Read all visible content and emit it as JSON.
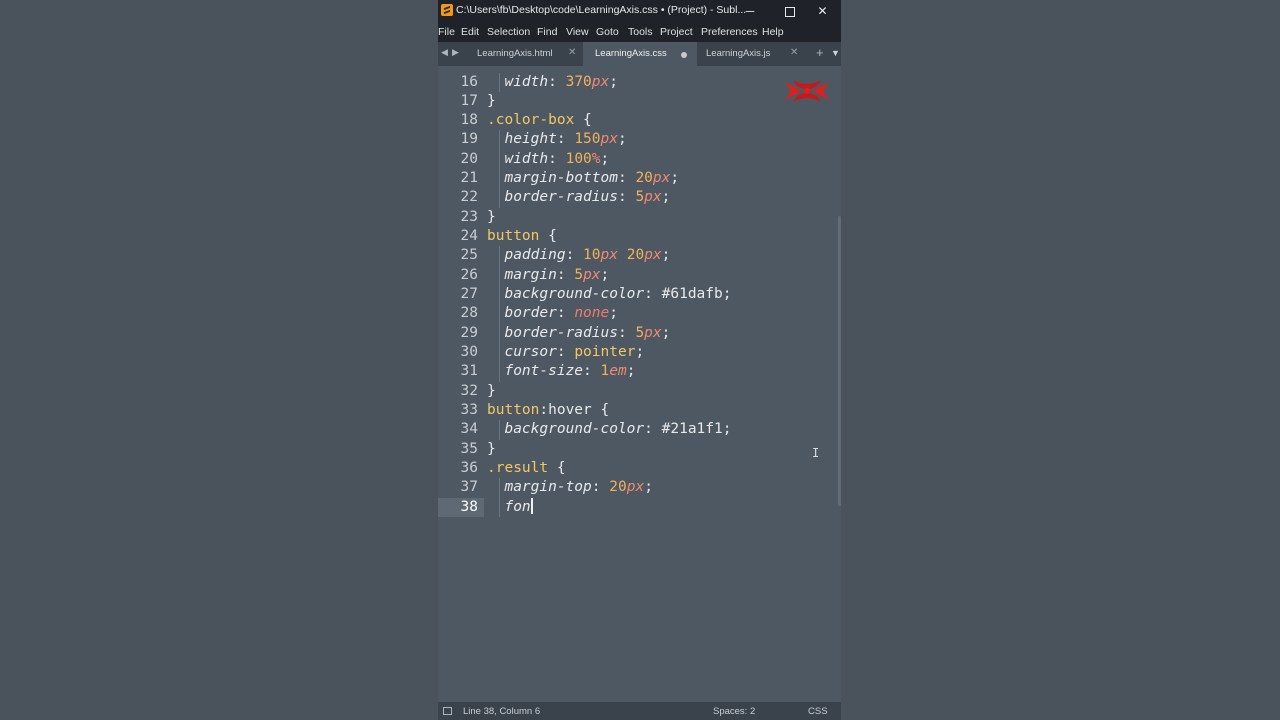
{
  "window": {
    "title": "C:\\Users\\fb\\Desktop\\code\\LearningAxis.css • (Project) - Subl...",
    "controls": {
      "minimize": "─",
      "maximize": "",
      "close": "✕"
    }
  },
  "menu": [
    "File",
    "Edit",
    "Selection",
    "Find",
    "View",
    "Goto",
    "Tools",
    "Project",
    "Preferences",
    "Help"
  ],
  "tabs": [
    {
      "label": "LearningAxis.html",
      "state": "close"
    },
    {
      "label": "LearningAxis.css",
      "state": "modified"
    },
    {
      "label": "LearningAxis.js",
      "state": "close"
    }
  ],
  "tab_controls": {
    "prev": "◀",
    "next": "▶",
    "add": "+",
    "dropdown": "▼",
    "close_glyph": "✕"
  },
  "editor": {
    "current_line": 38,
    "lines": [
      {
        "n": "16",
        "tokens": [
          [
            "i",
            "  "
          ],
          [
            "prop",
            "width"
          ],
          [
            "pc",
            ": "
          ],
          [
            "num",
            "370"
          ],
          [
            "unit",
            "px"
          ],
          [
            "pc",
            ";"
          ]
        ]
      },
      {
        "n": "17",
        "tokens": [
          [
            "pc",
            "}"
          ]
        ]
      },
      {
        "n": "18",
        "tokens": [
          [
            "sel",
            ".color-box"
          ],
          [
            "pc",
            " {"
          ]
        ]
      },
      {
        "n": "19",
        "tokens": [
          [
            "i",
            "  "
          ],
          [
            "prop",
            "height"
          ],
          [
            "pc",
            ": "
          ],
          [
            "num",
            "150"
          ],
          [
            "unit",
            "px"
          ],
          [
            "pc",
            ";"
          ]
        ]
      },
      {
        "n": "20",
        "tokens": [
          [
            "i",
            "  "
          ],
          [
            "prop",
            "width"
          ],
          [
            "pc",
            ": "
          ],
          [
            "num",
            "100"
          ],
          [
            "unit",
            "%"
          ],
          [
            "pc",
            ";"
          ]
        ]
      },
      {
        "n": "21",
        "tokens": [
          [
            "i",
            "  "
          ],
          [
            "prop",
            "margin-bottom"
          ],
          [
            "pc",
            ": "
          ],
          [
            "num",
            "20"
          ],
          [
            "unit",
            "px"
          ],
          [
            "pc",
            ";"
          ]
        ]
      },
      {
        "n": "22",
        "tokens": [
          [
            "i",
            "  "
          ],
          [
            "prop",
            "border-radius"
          ],
          [
            "pc",
            ": "
          ],
          [
            "num",
            "5"
          ],
          [
            "unit",
            "px"
          ],
          [
            "pc",
            ";"
          ]
        ]
      },
      {
        "n": "23",
        "tokens": [
          [
            "pc",
            "}"
          ]
        ]
      },
      {
        "n": "24",
        "tokens": [
          [
            "sel",
            "button"
          ],
          [
            "pc",
            " {"
          ]
        ]
      },
      {
        "n": "25",
        "tokens": [
          [
            "i",
            "  "
          ],
          [
            "prop",
            "padding"
          ],
          [
            "pc",
            ": "
          ],
          [
            "num",
            "10"
          ],
          [
            "unit",
            "px"
          ],
          [
            "pc",
            " "
          ],
          [
            "num",
            "20"
          ],
          [
            "unit",
            "px"
          ],
          [
            "pc",
            ";"
          ]
        ]
      },
      {
        "n": "26",
        "tokens": [
          [
            "i",
            "  "
          ],
          [
            "prop",
            "margin"
          ],
          [
            "pc",
            ": "
          ],
          [
            "num",
            "5"
          ],
          [
            "unit",
            "px"
          ],
          [
            "pc",
            ";"
          ]
        ]
      },
      {
        "n": "27",
        "tokens": [
          [
            "i",
            "  "
          ],
          [
            "prop",
            "background-color"
          ],
          [
            "pc",
            ": "
          ],
          [
            "hex",
            "#61dafb"
          ],
          [
            "pc",
            ";"
          ]
        ]
      },
      {
        "n": "28",
        "tokens": [
          [
            "i",
            "  "
          ],
          [
            "prop",
            "border"
          ],
          [
            "pc",
            ": "
          ],
          [
            "kw",
            "none"
          ],
          [
            "pc",
            ";"
          ]
        ]
      },
      {
        "n": "29",
        "tokens": [
          [
            "i",
            "  "
          ],
          [
            "prop",
            "border-radius"
          ],
          [
            "pc",
            ": "
          ],
          [
            "num",
            "5"
          ],
          [
            "unit",
            "px"
          ],
          [
            "pc",
            ";"
          ]
        ]
      },
      {
        "n": "30",
        "tokens": [
          [
            "i",
            "  "
          ],
          [
            "prop",
            "cursor"
          ],
          [
            "pc",
            ": "
          ],
          [
            "sel",
            "pointer"
          ],
          [
            "pc",
            ";"
          ]
        ]
      },
      {
        "n": "31",
        "tokens": [
          [
            "i",
            "  "
          ],
          [
            "prop",
            "font-size"
          ],
          [
            "pc",
            ": "
          ],
          [
            "num",
            "1"
          ],
          [
            "unit",
            "em"
          ],
          [
            "pc",
            ";"
          ]
        ]
      },
      {
        "n": "32",
        "tokens": [
          [
            "pc",
            "}"
          ]
        ]
      },
      {
        "n": "33",
        "tokens": [
          [
            "sel",
            "button"
          ],
          [
            "pc",
            ":hover {"
          ]
        ]
      },
      {
        "n": "34",
        "tokens": [
          [
            "i",
            "  "
          ],
          [
            "prop",
            "background-color"
          ],
          [
            "pc",
            ": "
          ],
          [
            "hex",
            "#21a1f1"
          ],
          [
            "pc",
            ";"
          ]
        ]
      },
      {
        "n": "35",
        "tokens": [
          [
            "pc",
            "}"
          ]
        ]
      },
      {
        "n": "36",
        "tokens": [
          [
            "sel",
            ".result"
          ],
          [
            "pc",
            " {"
          ]
        ]
      },
      {
        "n": "37",
        "tokens": [
          [
            "i",
            "  "
          ],
          [
            "prop",
            "margin-top"
          ],
          [
            "pc",
            ": "
          ],
          [
            "num",
            "20"
          ],
          [
            "unit",
            "px"
          ],
          [
            "pc",
            ";"
          ]
        ]
      },
      {
        "n": "38",
        "tokens": [
          [
            "i",
            "  "
          ],
          [
            "prop",
            "fon"
          ]
        ]
      }
    ]
  },
  "status": {
    "position": "Line 38, Column 6",
    "spaces": "Spaces: 2",
    "syntax": "CSS"
  },
  "colors": {
    "titlebar": "#1f2329",
    "editor_bg": "#4d5863",
    "page_bg": "#4a535c",
    "logo_red": "#e01e1e"
  }
}
